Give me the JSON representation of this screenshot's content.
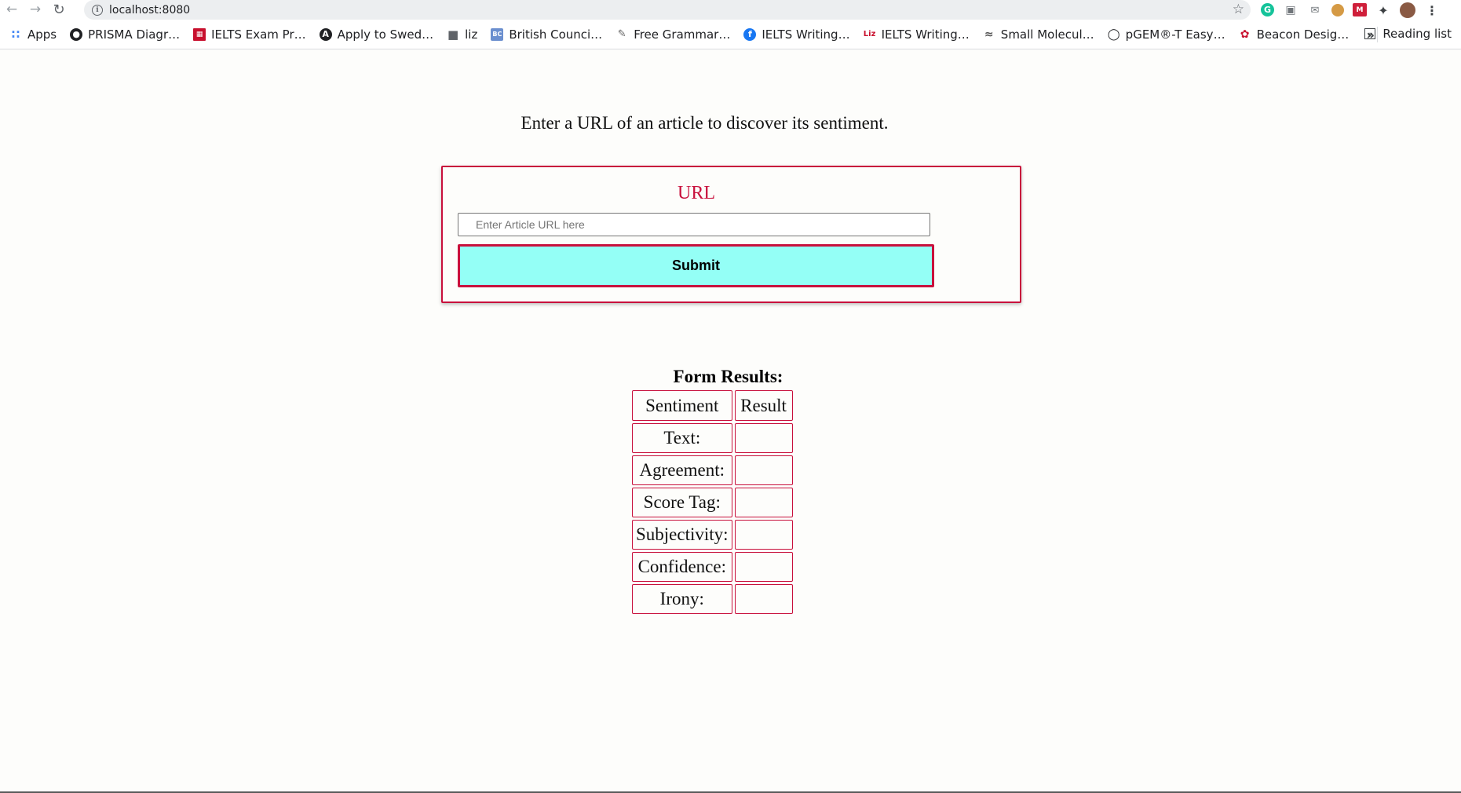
{
  "browser": {
    "url": "localhost:8080",
    "bookmarks": [
      {
        "label": "Apps",
        "icon": "apps-grid-icon"
      },
      {
        "label": "PRISMA Diagr…",
        "icon": "prisma-icon"
      },
      {
        "label": "IELTS Exam Pr…",
        "icon": "ielts-icon"
      },
      {
        "label": "Apply to Swed…",
        "icon": "apply-icon"
      },
      {
        "label": "liz",
        "icon": "folder-icon"
      },
      {
        "label": "British Counci…",
        "icon": "british-council-icon"
      },
      {
        "label": "Free Grammar…",
        "icon": "grammar-icon"
      },
      {
        "label": "IELTS Writing…",
        "icon": "facebook-icon"
      },
      {
        "label": "IELTS Writing…",
        "icon": "liz-icon"
      },
      {
        "label": "Small Molecul…",
        "icon": "molecule-icon"
      },
      {
        "label": "pGEM®-T Easy…",
        "icon": "pgem-icon"
      },
      {
        "label": "Beacon Desig…",
        "icon": "beacon-icon"
      }
    ],
    "overflow": "»",
    "reading_list": "Reading list"
  },
  "page": {
    "heading": "Enter a URL of an article to discover its sentiment.",
    "form": {
      "label": "URL",
      "input_placeholder": "Enter Article URL here",
      "input_value": "",
      "submit_label": "Submit"
    },
    "results": {
      "title": "Form Results:",
      "headers": [
        "Sentiment",
        "Result"
      ],
      "rows": [
        {
          "label": "Text:",
          "value": ""
        },
        {
          "label": "Agreement:",
          "value": ""
        },
        {
          "label": "Score Tag:",
          "value": ""
        },
        {
          "label": "Subjectivity:",
          "value": ""
        },
        {
          "label": "Confidence:",
          "value": ""
        },
        {
          "label": "Irony:",
          "value": ""
        }
      ]
    }
  },
  "colors": {
    "accent": "#c8103c",
    "submit_bg": "#94fff6",
    "page_bg": "#fdfdfb"
  }
}
